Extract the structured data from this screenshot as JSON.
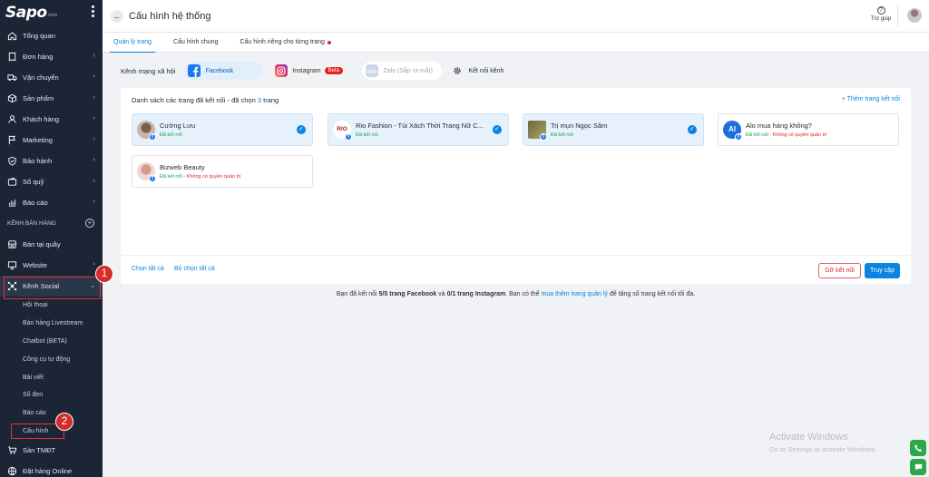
{
  "app": {
    "logo": "Sapo",
    "logo_sub": "omni"
  },
  "sidebar": {
    "items": [
      {
        "label": "Tổng quan",
        "icon": "home-icon",
        "chev": false
      },
      {
        "label": "Đơn hàng",
        "icon": "receipt-icon",
        "chev": true
      },
      {
        "label": "Vận chuyển",
        "icon": "truck-icon",
        "chev": true
      },
      {
        "label": "Sản phẩm",
        "icon": "box-icon",
        "chev": true
      },
      {
        "label": "Khách hàng",
        "icon": "user-icon",
        "chev": true
      },
      {
        "label": "Marketing",
        "icon": "flag-icon",
        "chev": true
      },
      {
        "label": "Bảo hành",
        "icon": "shield-icon",
        "chev": true
      },
      {
        "label": "Sổ quỹ",
        "icon": "wallet-icon",
        "chev": true
      },
      {
        "label": "Báo cáo",
        "icon": "chart-icon",
        "chev": true
      }
    ],
    "section_label": "KÊNH BÁN HÀNG",
    "channel_items": [
      {
        "label": "Bán tại quầy",
        "icon": "store-icon",
        "chev": false
      },
      {
        "label": "Website",
        "icon": "monitor-icon",
        "chev": true
      }
    ],
    "social": {
      "label": "Kênh Social",
      "icon": "network-icon"
    },
    "social_sub": [
      "Hội thoại",
      "Bán hàng Livestream",
      "Chatbot (BETA)",
      "Công cụ tự động",
      "Bài viết",
      "Sổ đen",
      "Báo cáo",
      "Cấu hình"
    ],
    "bottom_items": [
      {
        "label": "Sàn TMĐT",
        "icon": "cart-icon"
      },
      {
        "label": "Đặt hàng Online",
        "icon": "globe-icon"
      }
    ],
    "annotations": [
      "1",
      "2"
    ]
  },
  "topbar": {
    "title": "Cấu hình hệ thống",
    "help_label": "Trợ giúp"
  },
  "tabs": [
    {
      "label": "Quản lý trang",
      "active": true
    },
    {
      "label": "Cấu hình chung",
      "active": false
    },
    {
      "label": "Cấu hình riêng cho từng trang",
      "active": false,
      "dot": true
    }
  ],
  "channels": {
    "label": "Kênh mạng xã hội",
    "facebook": "Facebook",
    "instagram": "Instagram",
    "beta": "Beta",
    "zalo": "Zalo (Sắp ra mắt)",
    "connect": "Kết nối kênh"
  },
  "card": {
    "title": "Danh sách các trang đã kết nối",
    "title_suffix": " - đã chọn ",
    "selected_count": "3",
    "selected_unit": " trang",
    "add_link": "Thêm trang kết nối",
    "pages": [
      {
        "name": "Cường Lưu",
        "status": "Đã kết nối",
        "warn": "",
        "selected": true
      },
      {
        "name": "Rio Fashion - Túi Xách Thời Trang Nữ C...",
        "status": "Đã kết nối",
        "warn": "",
        "selected": true,
        "avatar_text": "RIO"
      },
      {
        "name": "Trị mụn Ngọc Sâm",
        "status": "Đã kết nối",
        "warn": "",
        "selected": true
      },
      {
        "name": "Alo mua hàng không?",
        "status": "Đã kết nối",
        "warn": " - Không có quyền quản trị",
        "selected": false,
        "avatar_text": "Al"
      },
      {
        "name": "Bizweb Beauty",
        "status": "Đã kết nối",
        "warn": " - Không có quyền quản trị",
        "selected": false
      }
    ],
    "select_all": "Chọn tất cả",
    "deselect_all": "Bỏ chọn tất cả",
    "disconnect": "Gỡ kết nối",
    "access": "Truy cập"
  },
  "info": {
    "prefix": "Bạn đã kết nối ",
    "fb_count": "5/5 trang Facebook",
    "mid": " và ",
    "ig_count": "0/1 trang Instagram",
    "mid2": ". Bạn có thể ",
    "link": "mua thêm trang quản lý",
    "suffix": " để tăng số trang kết nối tối đa."
  },
  "watermark": {
    "line1": "Activate Windows",
    "line2": "Go to Settings to activate Windows."
  },
  "colors": {
    "primary": "#0a84e0",
    "sidebar": "#1c2536",
    "danger": "#e02424",
    "success": "#16a34a"
  }
}
